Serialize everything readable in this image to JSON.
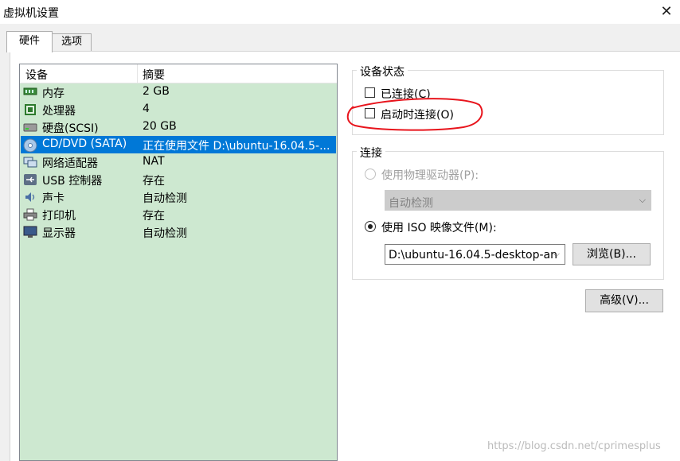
{
  "window": {
    "title": "虚拟机设置"
  },
  "tabs": [
    {
      "label": "硬件"
    },
    {
      "label": "选项"
    }
  ],
  "devices": {
    "col_device": "设备",
    "col_summary": "摘要",
    "rows": [
      {
        "name": "内存",
        "summary": "2 GB",
        "icon": "memory-icon"
      },
      {
        "name": "处理器",
        "summary": "4",
        "icon": "processor-icon"
      },
      {
        "name": "硬盘(SCSI)",
        "summary": "20 GB",
        "icon": "hard-disk-icon"
      },
      {
        "name": "CD/DVD (SATA)",
        "summary": "正在使用文件 D:\\ubuntu-16.04.5-...",
        "icon": "cd-dvd-icon",
        "selected": true
      },
      {
        "name": "网络适配器",
        "summary": "NAT",
        "icon": "network-adapter-icon"
      },
      {
        "name": "USB 控制器",
        "summary": "存在",
        "icon": "usb-icon"
      },
      {
        "name": "声卡",
        "summary": "自动检测",
        "icon": "sound-card-icon"
      },
      {
        "name": "打印机",
        "summary": "存在",
        "icon": "printer-icon"
      },
      {
        "name": "显示器",
        "summary": "自动检测",
        "icon": "display-icon"
      }
    ]
  },
  "device_status": {
    "title": "设备状态",
    "connected": "已连接(C)",
    "connect_at_power_on": "启动时连接(O)"
  },
  "connection": {
    "title": "连接",
    "use_physical": "使用物理驱动器(P):",
    "physical_value": "自动检测",
    "use_iso": "使用 ISO 映像文件(M):",
    "iso_value": "D:\\ubuntu-16.04.5-desktop-an",
    "browse": "浏览(B)..."
  },
  "advanced": "高级(V)...",
  "watermark": "https://blog.csdn.net/cprimesplus",
  "colors": {
    "selection": "#0078d7",
    "list_bg": "#cde8d0",
    "annotation": "#e8141c"
  }
}
